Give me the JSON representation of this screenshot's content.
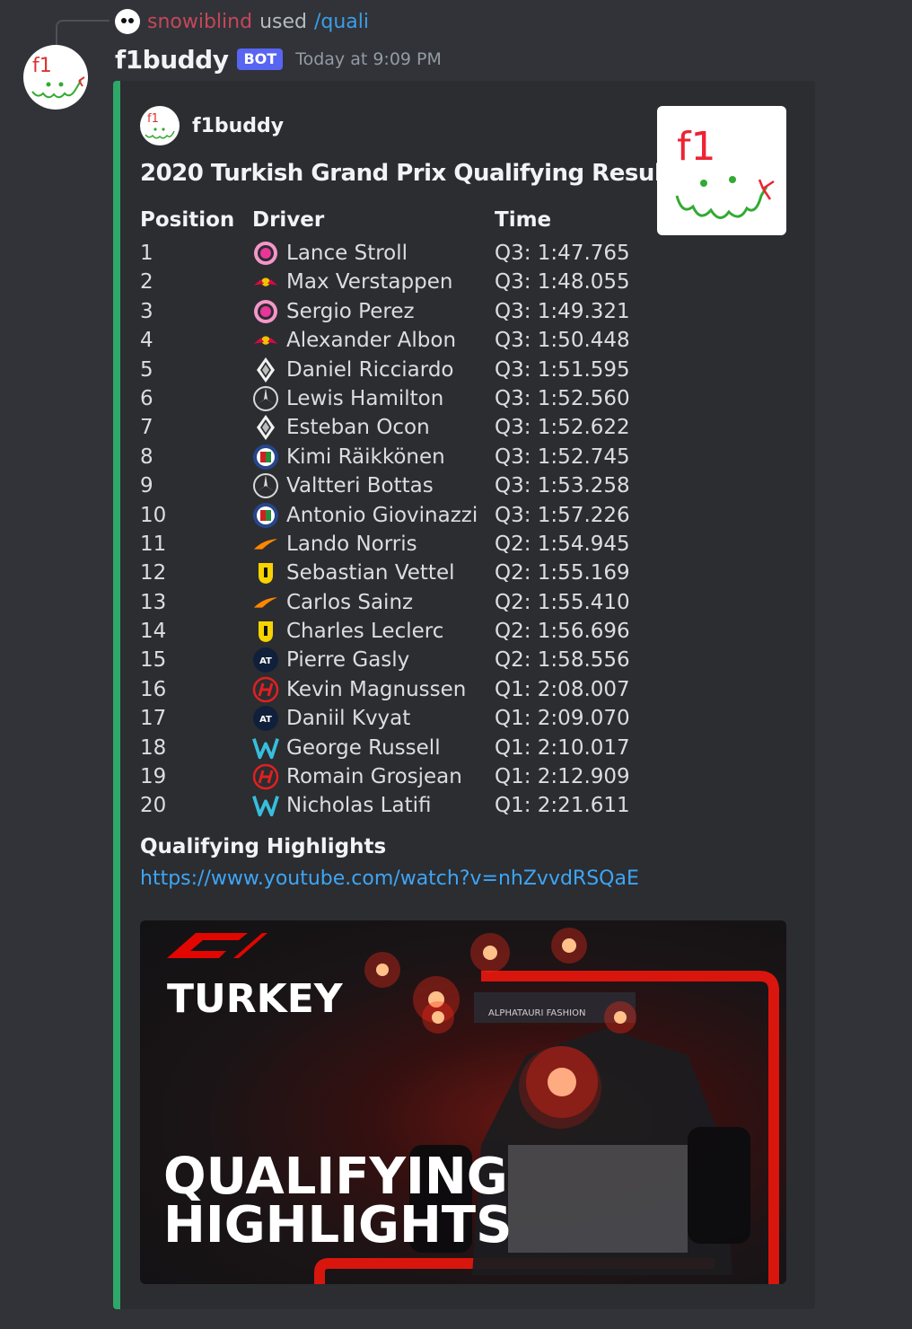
{
  "reply": {
    "user": "snowiblind",
    "used": "used",
    "command": "/quali"
  },
  "message": {
    "author": "f1buddy",
    "tag": "BOT",
    "timestamp": "Today at 9:09 PM"
  },
  "embed": {
    "accent_color": "#2ea868",
    "author": "f1buddy",
    "title": "2020 Turkish Grand Prix Qualifying Results",
    "thumbnail_text": "f1",
    "columns": {
      "position": "Position",
      "driver": "Driver",
      "time": "Time"
    },
    "rows": [
      {
        "pos": "1",
        "team": "racing-point",
        "driver": "Lance Stroll",
        "time": "Q3: 1:47.765"
      },
      {
        "pos": "2",
        "team": "red-bull",
        "driver": "Max Verstappen",
        "time": "Q3: 1:48.055"
      },
      {
        "pos": "3",
        "team": "racing-point",
        "driver": "Sergio Perez",
        "time": "Q3: 1:49.321"
      },
      {
        "pos": "4",
        "team": "red-bull",
        "driver": "Alexander Albon",
        "time": "Q3: 1:50.448"
      },
      {
        "pos": "5",
        "team": "renault",
        "driver": "Daniel Ricciardo",
        "time": "Q3: 1:51.595"
      },
      {
        "pos": "6",
        "team": "mercedes",
        "driver": "Lewis Hamilton",
        "time": "Q3: 1:52.560"
      },
      {
        "pos": "7",
        "team": "renault",
        "driver": "Esteban Ocon",
        "time": "Q3: 1:52.622"
      },
      {
        "pos": "8",
        "team": "alfa-romeo",
        "driver": "Kimi Räikkönen",
        "time": "Q3: 1:52.745"
      },
      {
        "pos": "9",
        "team": "mercedes",
        "driver": "Valtteri Bottas",
        "time": "Q3: 1:53.258"
      },
      {
        "pos": "10",
        "team": "alfa-romeo",
        "driver": "Antonio Giovinazzi",
        "time": "Q3: 1:57.226"
      },
      {
        "pos": "11",
        "team": "mclaren",
        "driver": "Lando Norris",
        "time": "Q2: 1:54.945"
      },
      {
        "pos": "12",
        "team": "ferrari",
        "driver": "Sebastian Vettel",
        "time": "Q2: 1:55.169"
      },
      {
        "pos": "13",
        "team": "mclaren",
        "driver": "Carlos Sainz",
        "time": "Q2: 1:55.410"
      },
      {
        "pos": "14",
        "team": "ferrari",
        "driver": "Charles Leclerc",
        "time": "Q2: 1:56.696"
      },
      {
        "pos": "15",
        "team": "alphatauri",
        "driver": "Pierre Gasly",
        "time": "Q2: 1:58.556"
      },
      {
        "pos": "16",
        "team": "haas",
        "driver": "Kevin Magnussen",
        "time": "Q1: 2:08.007"
      },
      {
        "pos": "17",
        "team": "alphatauri",
        "driver": "Daniil Kvyat",
        "time": "Q1: 2:09.070"
      },
      {
        "pos": "18",
        "team": "williams",
        "driver": "George Russell",
        "time": "Q1: 2:10.017"
      },
      {
        "pos": "19",
        "team": "haas",
        "driver": "Romain Grosjean",
        "time": "Q1: 2:12.909"
      },
      {
        "pos": "20",
        "team": "williams",
        "driver": "Nicholas Latifi",
        "time": "Q1: 2:21.611"
      }
    ],
    "highlights_title": "Qualifying Highlights",
    "highlights_link": "https://www.youtube.com/watch?v=nhZvvdRSQaE",
    "image": {
      "line1": "TURKEY",
      "line2": "QUALIFYING",
      "line3": "HIGHLIGHTS",
      "car_text": "ALPHATAURI FASHION"
    }
  }
}
